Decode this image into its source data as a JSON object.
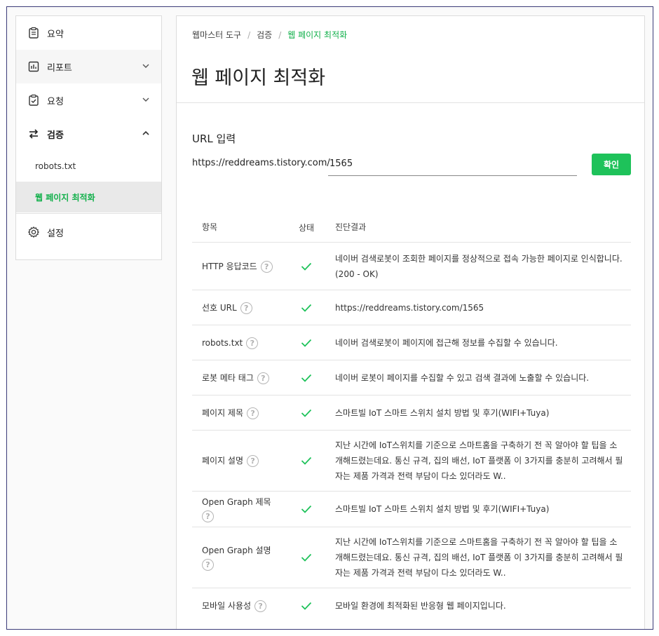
{
  "sidebar": {
    "items": [
      {
        "label": "요약",
        "icon": "clipboard-icon"
      },
      {
        "label": "리포트",
        "icon": "bar-chart-icon"
      },
      {
        "label": "요청",
        "icon": "checklist-icon"
      },
      {
        "label": "검증",
        "icon": "swap-arrows-icon"
      }
    ],
    "sub_items": [
      {
        "label": "robots.txt"
      },
      {
        "label": "웹 페이지 최적화"
      }
    ],
    "settings": {
      "label": "설정",
      "icon": "gear-icon"
    }
  },
  "breadcrumb": [
    "웹마스터 도구",
    "검증",
    "웹 페이지 최적화"
  ],
  "page_title": "웹 페이지 최적화",
  "url_form": {
    "label": "URL 입력",
    "prefix": "https://reddreams.tistory.com/",
    "value": "1565",
    "button": "확인"
  },
  "table": {
    "headers": [
      "항목",
      "상태",
      "진단결과"
    ],
    "rows": [
      {
        "item": "HTTP 응답코드",
        "status": "ok",
        "result": "네이버 검색로봇이 조회한 페이지를 정상적으로 접속 가능한 페이지로 인식합니다.(200 - OK)"
      },
      {
        "item": "선호 URL",
        "status": "ok",
        "result": "https://reddreams.tistory.com/1565"
      },
      {
        "item": "robots.txt",
        "status": "ok",
        "result": "네이버 검색로봇이 페이지에 접근해 정보를 수집할 수 있습니다."
      },
      {
        "item": "로봇 메타 태그",
        "status": "ok",
        "result": "네이버 로봇이 페이지를 수집할 수 있고 검색 결과에 노출할 수 있습니다."
      },
      {
        "item": "페이지 제목",
        "status": "ok",
        "result": "스마트빌 IoT 스마트 스위치 설치 방법 및 후기(WIFI+Tuya)"
      },
      {
        "item": "페이지 설명",
        "status": "ok",
        "result": "지난 시간에 IoT스위치를 기준으로 스마트홈을 구축하기 전 꼭 알아야 할 팁을 소개해드렸는데요. 통신 규격, 집의 배선, IoT 플랫폼 이 3가지를 충분히 고려해서 필자는 제품 가격과 전력 부담이 다소 있더라도 W.."
      },
      {
        "item": "Open Graph 제목",
        "status": "ok",
        "result": "스마트빌 IoT 스마트 스위치 설치 방법 및 후기(WIFI+Tuya)"
      },
      {
        "item": "Open Graph 설명",
        "status": "ok",
        "result": "지난 시간에 IoT스위치를 기준으로 스마트홈을 구축하기 전 꼭 알아야 할 팁을 소개해드렸는데요. 통신 규격, 집의 배선, IoT 플랫폼 이 3가지를 충분히 고려해서 필자는 제품 가격과 전력 부담이 다소 있더라도 W.."
      },
      {
        "item": "모바일 사용성",
        "status": "ok",
        "result": "모바일 환경에 최적화된 반응형 웹 페이지입니다."
      }
    ]
  },
  "help_glyph": "?",
  "colors": {
    "accent": "#12b04b",
    "button": "#1ec25a",
    "check": "#1ec25a"
  }
}
